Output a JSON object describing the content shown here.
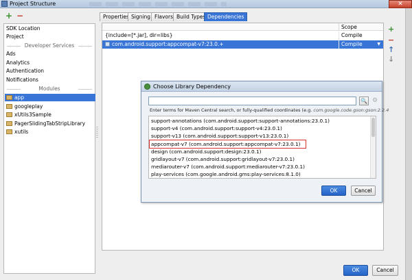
{
  "window": {
    "title": "Project Structure",
    "close_glyph": "✕"
  },
  "left_toolbar": {
    "add": "+",
    "remove": "−"
  },
  "sidebar": {
    "top_items": [
      "SDK Location",
      "Project"
    ],
    "developer_services_label": "Developer Services",
    "service_items": [
      "Ads",
      "Analytics",
      "Authentication",
      "Notifications"
    ],
    "modules_label": "Modules",
    "modules": [
      "app",
      "googleplay",
      "xUtils3Sample",
      "PagerSlidingTabStripLibrary",
      "xutils"
    ],
    "selected_module": "app"
  },
  "tabs": [
    {
      "label": "Properties",
      "active": false
    },
    {
      "label": "Signing",
      "active": false
    },
    {
      "label": "Flavors",
      "active": false
    },
    {
      "label": "Build Types",
      "active": false
    },
    {
      "label": "Dependencies",
      "active": true
    }
  ],
  "dependencies": {
    "scope_header": "Scope",
    "rows": [
      {
        "name": "{include=[*.jar], dir=libs}",
        "scope": "Compile",
        "selected": false
      },
      {
        "name": "com.android.support:appcompat-v7:23.0.+",
        "scope": "Compile",
        "selected": true
      }
    ]
  },
  "right_tools": {
    "add": "+",
    "remove": "−",
    "up": "↑",
    "down": "↓"
  },
  "dialog": {
    "title": "Choose Library Dependency",
    "search_value": "",
    "search_icon": "🔍",
    "gear_icon": "⚙",
    "hint_prefix": "Enter terms for Maven Central search, or fully-qualified coordinates (e.g.",
    "hint_example": "com.google.code.gson:gson:2.2.4",
    "items": [
      "support-annotations (com.android.support:support-annotations:23.0.1)",
      "support-v4 (com.android.support:support-v4:23.0.1)",
      "support-v13 (com.android.support:support-v13:23.0.1)",
      "appcompat-v7 (com.android.support:appcompat-v7:23.0.1)",
      "design (com.android.support:design:23.0.1)",
      "gridlayout-v7 (com.android.support:gridlayout-v7:23.0.1)",
      "mediarouter-v7 (com.android.support:mediarouter-v7:23.0.1)",
      "play-services (com.google.android.gms:play-services:8.1.0)"
    ],
    "ok_label": "OK",
    "cancel_label": "Cancel"
  },
  "footer": {
    "ok_label": "OK",
    "cancel_label": "Cancel"
  }
}
